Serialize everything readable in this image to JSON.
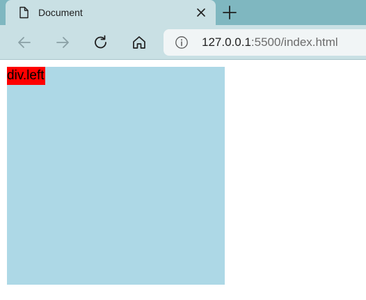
{
  "browser": {
    "tab": {
      "title": "Document",
      "icon": "document-icon"
    },
    "toolbar": {
      "back_icon": "arrow-left-icon",
      "forward_icon": "arrow-right-icon",
      "refresh_icon": "refresh-icon",
      "home_icon": "home-icon"
    },
    "address": {
      "host": "127.0.0.1",
      "rest": ":5500/index.html",
      "icon": "info-icon"
    },
    "colors": {
      "tabstrip": "#7fb7c0",
      "toolbar": "#c9e0e4"
    }
  },
  "page": {
    "left_div": {
      "label": "div.left",
      "background": "#add8e6",
      "label_background": "#ff0000"
    }
  }
}
